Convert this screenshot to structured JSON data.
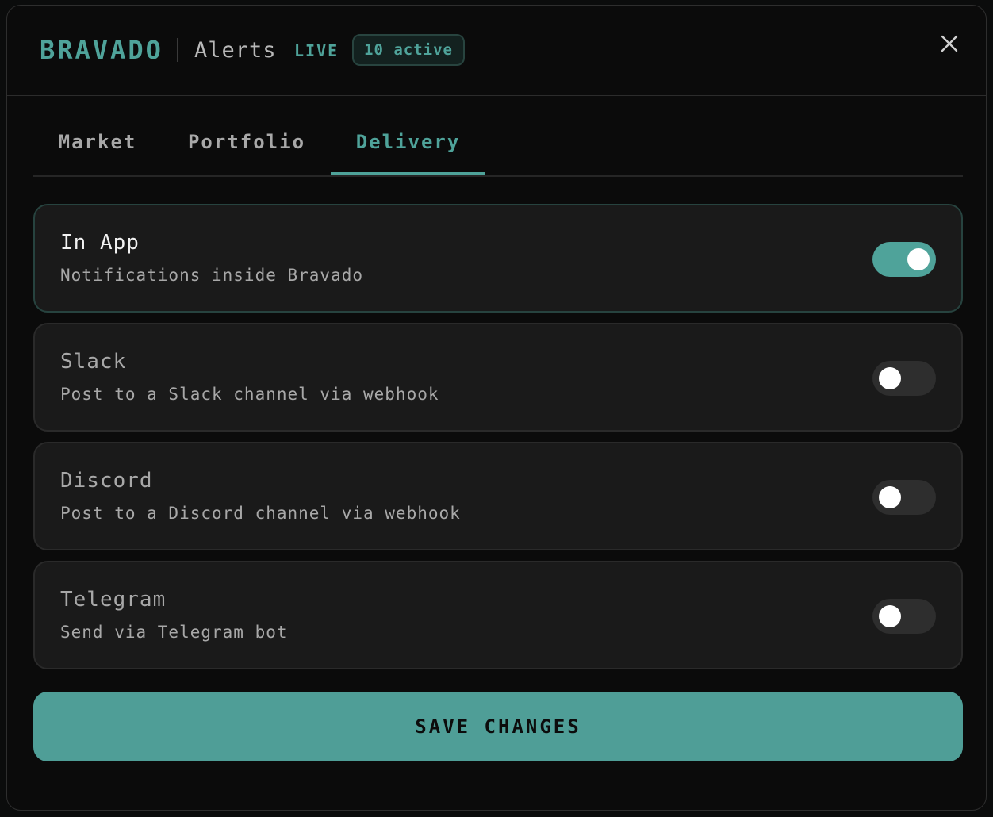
{
  "header": {
    "brand": "BRAVADO",
    "subtitle": "Alerts",
    "live_label": "LIVE",
    "active_badge": "10 active",
    "close_icon": "close-icon"
  },
  "tabs": [
    {
      "label": "Market",
      "active": false
    },
    {
      "label": "Portfolio",
      "active": false
    },
    {
      "label": "Delivery",
      "active": true
    }
  ],
  "channels": [
    {
      "title": "In App",
      "description": "Notifications inside Bravado",
      "enabled": true
    },
    {
      "title": "Slack",
      "description": "Post to a Slack channel via webhook",
      "enabled": false
    },
    {
      "title": "Discord",
      "description": "Post to a Discord channel via webhook",
      "enabled": false
    },
    {
      "title": "Telegram",
      "description": "Send via Telegram bot",
      "enabled": false
    }
  ],
  "save_label": "SAVE CHANGES",
  "colors": {
    "accent": "#4fa39a",
    "surface": "#1a1a1a",
    "background": "#0b0b0b",
    "toggle_off": "#2e2e2e"
  }
}
